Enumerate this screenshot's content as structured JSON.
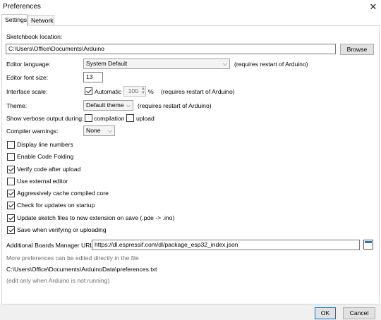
{
  "window": {
    "title": "Preferences",
    "close_glyph": "✕"
  },
  "tabs": [
    {
      "label": "Settings"
    },
    {
      "label": "Network"
    }
  ],
  "sketchbook": {
    "label": "Sketchbook location:",
    "value": "C:\\Users\\Office\\Documents\\Arduino",
    "browse_label": "Browse"
  },
  "editor_language": {
    "label": "Editor language:",
    "value": "System Default",
    "note": "(requires restart of Arduino)"
  },
  "font_size": {
    "label": "Editor font size:",
    "value": "13"
  },
  "interface_scale": {
    "label": "Interface scale:",
    "automatic_label": "Automatic",
    "automatic_checked": true,
    "value": "100",
    "unit": "%",
    "note": "(requires restart of Arduino)"
  },
  "theme": {
    "label": "Theme:",
    "value": "Default theme",
    "note": "(requires restart of Arduino)"
  },
  "verbose": {
    "label": "Show verbose output during:",
    "compilation_label": "compilation",
    "upload_label": "upload",
    "compilation_checked": false,
    "upload_checked": false
  },
  "compiler_warnings": {
    "label": "Compiler warnings:",
    "value": "None"
  },
  "options": [
    {
      "label": "Display line numbers",
      "checked": false
    },
    {
      "label": "Enable Code Folding",
      "checked": false
    },
    {
      "label": "Verify code after upload",
      "checked": true
    },
    {
      "label": "Use external editor",
      "checked": false
    },
    {
      "label": "Aggressively cache compiled core",
      "checked": true
    },
    {
      "label": "Check for updates on startup",
      "checked": true
    },
    {
      "label": "Update sketch files to new extension on save (.pde -> .ino)",
      "checked": true
    },
    {
      "label": "Save when verifying or uploading",
      "checked": true
    }
  ],
  "boards_manager": {
    "label": "Additional Boards Manager URLs:",
    "value": "https://dl.espressif.com/dl/package_esp32_index.json",
    "icon": "window-icon"
  },
  "info": {
    "more_prefs": "More preferences can be edited directly in the file",
    "path": "C:\\Users\\Office\\Documents\\ArduinoData\\preferences.txt",
    "edit_note": "(edit only when Arduino is not running)"
  },
  "footer": {
    "ok_label": "OK",
    "cancel_label": "Cancel"
  }
}
